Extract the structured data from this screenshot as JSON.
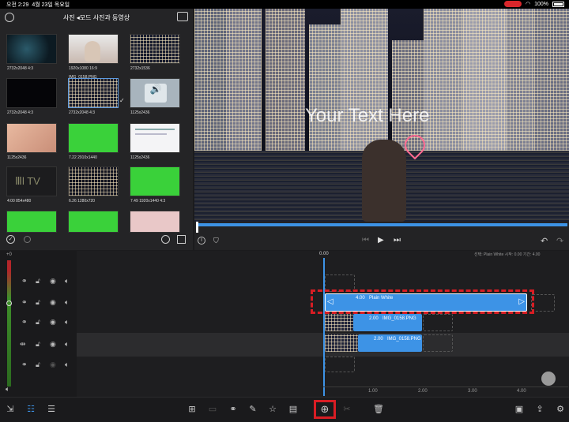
{
  "status_bar": {
    "time": "오전 2:29",
    "date": "4월 23일 목요일",
    "battery": "100%"
  },
  "browser": {
    "title": "사진 ◂모드 사진과 동영상",
    "items": [
      {
        "caption": "2732x2048  4:3"
      },
      {
        "caption": "1920x1080  16:9"
      },
      {
        "caption": "2732x1536"
      },
      {
        "caption": "IMG_0158.PNG"
      },
      {
        "caption": "2732x2048  4:3"
      },
      {
        "caption": "2732x2048  4:3"
      },
      {
        "caption": "1125x2436"
      },
      {
        "caption": "1125x2436"
      },
      {
        "caption": "7.22  2910x1440"
      },
      {
        "caption": "1125x2436"
      },
      {
        "caption": "4:00  854x480"
      },
      {
        "caption": "6.26  1280x720"
      },
      {
        "caption": "7.49  1920x1440  4:3"
      }
    ]
  },
  "preview": {
    "overlay_text": "Your Text Here"
  },
  "timeline": {
    "selection_info": "선택: Plain White 시작: 0.00 기간: 4.00",
    "playhead": "0.00",
    "ruler": [
      "1.00",
      "2.00",
      "3.00",
      "4.00"
    ],
    "level_label": "+0",
    "clips": [
      {
        "duration": "4.00",
        "name": "Plain White"
      },
      {
        "duration": "2.00",
        "name": "IMG_0158.PNG"
      },
      {
        "duration": "2.00",
        "name": "IMG_0158.PNG"
      }
    ]
  },
  "colors": {
    "clip_blue": "#3d93e6",
    "highlight_red": "#d81d24"
  }
}
